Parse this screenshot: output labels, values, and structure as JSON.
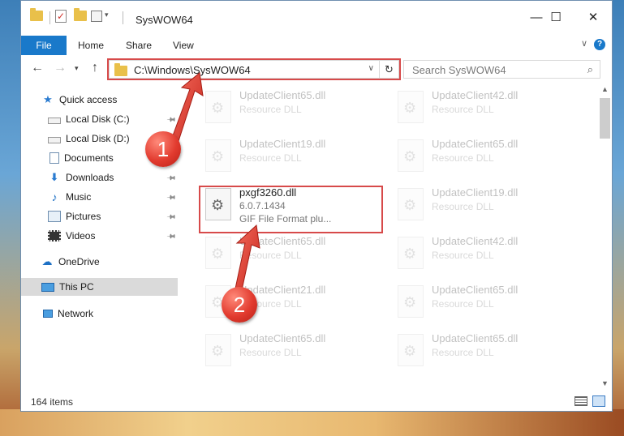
{
  "window": {
    "title": "SysWOW64",
    "quick_access_dropdown": "▾",
    "minimize": "—",
    "maximize": "☐",
    "close": "✕"
  },
  "ribbon": {
    "tabs": [
      "File",
      "Home",
      "Share",
      "View"
    ],
    "collapse_chevron": "∨",
    "help": "?"
  },
  "navigation": {
    "back": "←",
    "forward": "→",
    "recent": "▾",
    "up": "↑",
    "address": "C:\\Windows\\SysWOW64",
    "address_dropdown": "∨",
    "refresh": "↻",
    "search_placeholder": "Search SysWOW64",
    "search_icon": "search-icon"
  },
  "sidebar": {
    "items": [
      {
        "label": "Quick access",
        "icon": "star-icon",
        "pinned": false
      },
      {
        "label": "Local Disk (C:)",
        "icon": "drive-icon",
        "pinned": true
      },
      {
        "label": "Local Disk (D:)",
        "icon": "drive-icon",
        "pinned": false
      },
      {
        "label": "Documents",
        "icon": "documents-icon",
        "pinned": true
      },
      {
        "label": "Downloads",
        "icon": "downloads-icon",
        "pinned": true
      },
      {
        "label": "Music",
        "icon": "music-icon",
        "pinned": true
      },
      {
        "label": "Pictures",
        "icon": "pictures-icon",
        "pinned": true
      },
      {
        "label": "Videos",
        "icon": "videos-icon",
        "pinned": true
      },
      {
        "label": "OneDrive",
        "icon": "onedrive-icon",
        "pinned": false
      },
      {
        "label": "This PC",
        "icon": "pc-icon",
        "pinned": false,
        "selected": true
      },
      {
        "label": "Network",
        "icon": "network-icon",
        "pinned": false
      }
    ]
  },
  "files": {
    "left_column": [
      {
        "name": "UpdateClient65.dll",
        "type": "Resource DLL"
      },
      {
        "name": "UpdateClient19.dll",
        "type": "Resource DLL"
      },
      {
        "name": "pxgf3260.dll",
        "version": "6.0.7.1434",
        "type": "GIF File Format plu...",
        "highlighted": true
      },
      {
        "name": "UpdateClient65.dll",
        "type": "Resource DLL"
      },
      {
        "name": "UpdateClient21.dll",
        "type": "Resource DLL"
      },
      {
        "name": "UpdateClient65.dll",
        "type": "Resource DLL"
      }
    ],
    "right_column": [
      {
        "name": "UpdateClient42.dll",
        "type": "Resource DLL"
      },
      {
        "name": "UpdateClient65.dll",
        "type": "Resource DLL"
      },
      {
        "name": "UpdateClient19.dll",
        "type": "Resource DLL"
      },
      {
        "name": "UpdateClient42.dll",
        "type": "Resource DLL"
      },
      {
        "name": "UpdateClient65.dll",
        "type": "Resource DLL"
      },
      {
        "name": "UpdateClient65.dll",
        "type": "Resource DLL"
      }
    ]
  },
  "status": {
    "item_count": "164 items"
  },
  "annotations": {
    "step1": "1",
    "step2": "2",
    "highlight_color": "#d74a4a"
  }
}
